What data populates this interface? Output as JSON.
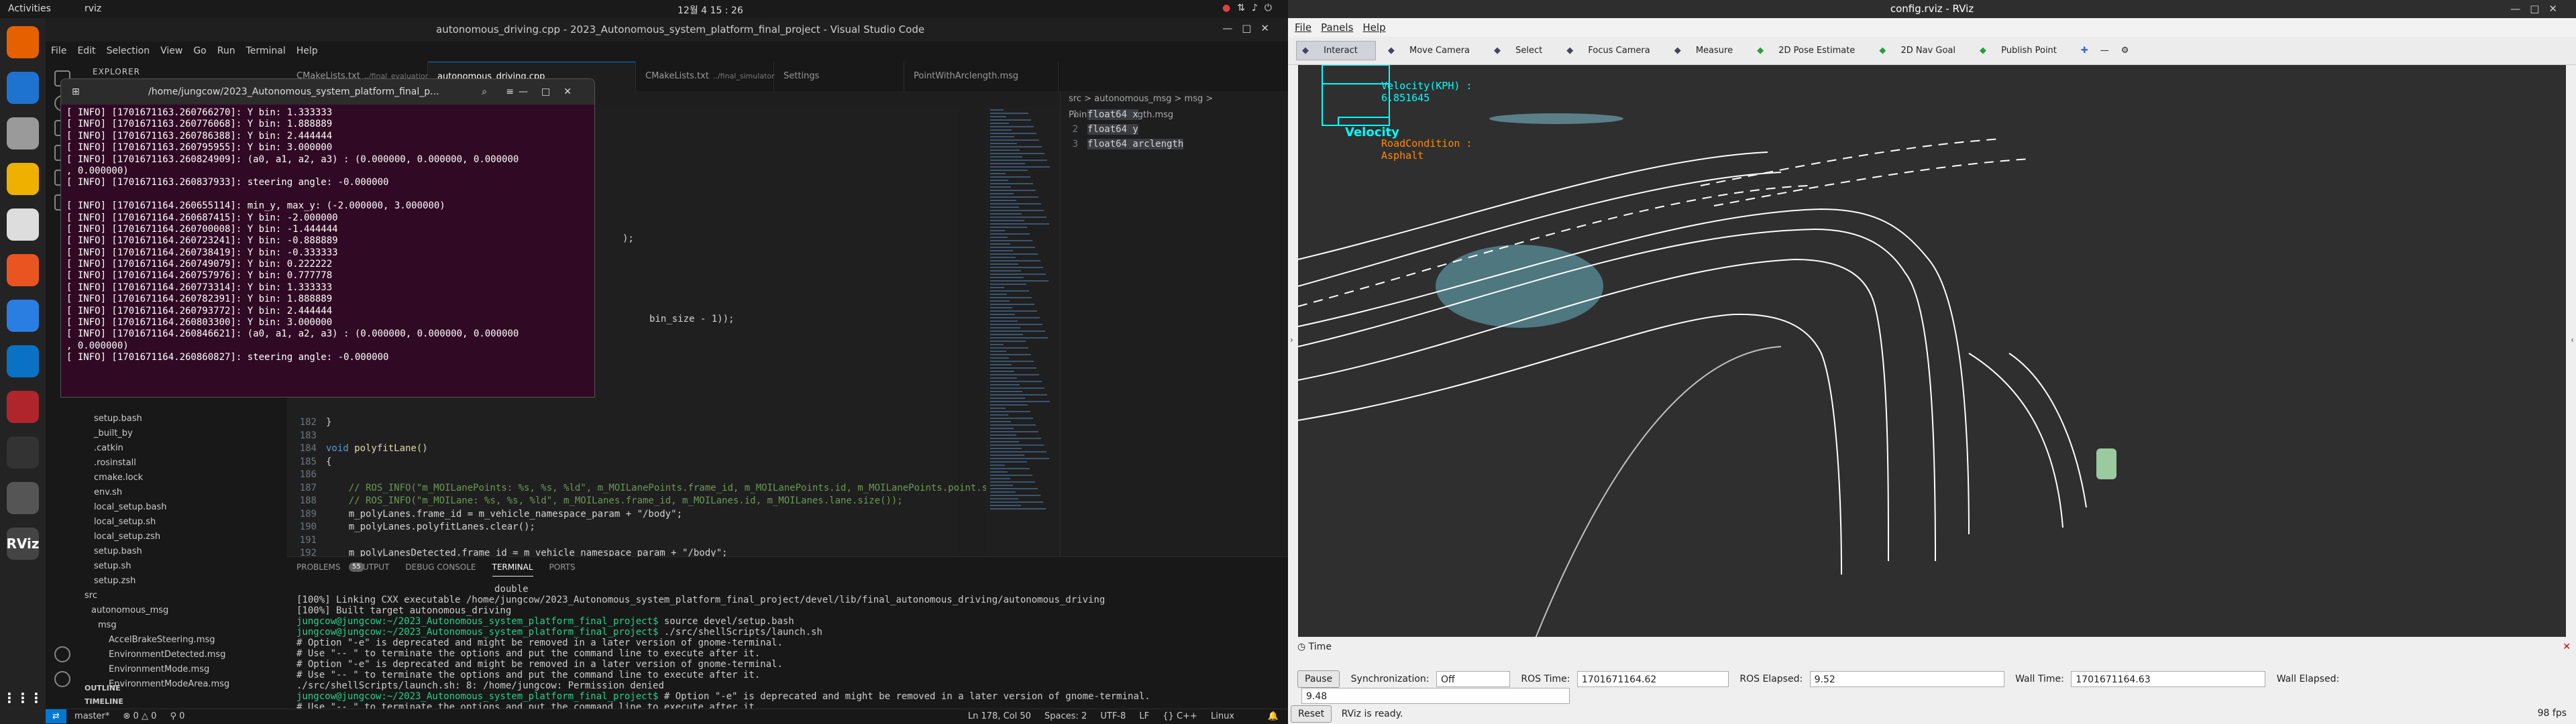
{
  "topbar": {
    "activities": "Activities",
    "app": "rviz",
    "clock": "12월 4 15 : 26"
  },
  "dock": [
    {
      "name": "firefox-icon",
      "color": "#e66000"
    },
    {
      "name": "thunderbird-icon",
      "color": "#1f73d0"
    },
    {
      "name": "files-icon",
      "color": "#9a9a9a"
    },
    {
      "name": "rhythmbox-icon",
      "color": "#f0b000"
    },
    {
      "name": "libreoffice-icon",
      "color": "#ddd"
    },
    {
      "name": "appcenter-icon",
      "color": "#e95420"
    },
    {
      "name": "help-icon",
      "color": "#2a7de1"
    },
    {
      "name": "vscode-icon",
      "color": "#0a72c4"
    },
    {
      "name": "terminal-red-icon",
      "color": "#b0252c"
    },
    {
      "name": "terminal-icon",
      "color": "#333"
    },
    {
      "name": "image-viewer-icon",
      "color": "#555"
    },
    {
      "name": "rviz-icon",
      "color": "#444",
      "label": "RViz"
    }
  ],
  "vscode": {
    "title": "autonomous_driving.cpp - 2023_Autonomous_system_platform_final_project - Visual Studio Code",
    "menu": [
      "File",
      "Edit",
      "Selection",
      "View",
      "Go",
      "Run",
      "Terminal",
      "Help"
    ],
    "explorer_title": "EXPLORER",
    "files": [
      "setup.bash",
      "_built_by",
      ".catkin",
      ".rosinstall",
      "cmake.lock",
      "env.sh",
      "local_setup.bash",
      "local_setup.sh",
      "local_setup.zsh",
      "setup.bash",
      "setup.sh",
      "setup.zsh",
      "src",
      "autonomous_msg",
      "msg",
      "AccelBrakeSteering.msg",
      "EnvironmentDetected.msg",
      "EnvironmentMode.msg",
      "EnvironmentModeArea.msg"
    ],
    "outline": "OUTLINE",
    "timeline": "TIMELINE",
    "tabs": [
      "CMakeLists.txt",
      "autonomous_driving.cpp",
      "CMakeLists.txt",
      "Settings",
      "PointWithArclength.msg"
    ],
    "tab_suffix": [
      "../final_evaluation",
      "",
      "../final_simulator",
      "",
      ""
    ],
    "breadcrumb": "src > autonomous_msg > msg > PointWithArclength.msg",
    "code": [
      {
        "n": "182",
        "k": "",
        "t": "}"
      },
      {
        "n": "183",
        "k": "",
        "t": ""
      },
      {
        "n": "184",
        "k": "void",
        "t": " polyfitLane()"
      },
      {
        "n": "185",
        "k": "",
        "t": "{"
      },
      {
        "n": "186",
        "k": "",
        "t": ""
      },
      {
        "n": "187",
        "k": "",
        "t": "    // ROS_INFO(\"m_MOILanePoints: %s, %s, %ld\", m_MOILanePoints.frame_id, m_MOILanePoints.id, m_MOILanePoints.point.size());"
      },
      {
        "n": "188",
        "k": "",
        "t": "    // ROS_INFO(\"m_MOILane: %s, %s, %ld\", m_MOILanes.frame_id, m_MOILanes.id, m_MOILanes.lane.size());"
      },
      {
        "n": "189",
        "k": "",
        "t": "    m_polyLanes.frame_id = m_vehicle_namespace_param + \"/body\";"
      },
      {
        "n": "190",
        "k": "",
        "t": "    m_polyLanes.polyfitLanes.clear();"
      },
      {
        "n": "191",
        "k": "",
        "t": ""
      },
      {
        "n": "192",
        "k": "",
        "t": "    m_polyLanesDetected.frame_id = m_vehicle_namespace_param + \"/body\";"
      }
    ],
    "code_frag1": ");",
    "code_frag2": "bin_size - 1));",
    "msg_lines": [
      "float64 x",
      "float64 y",
      "float64 arclength"
    ],
    "panel_tabs": [
      "PROBLEMS",
      "OUTPUT",
      "DEBUG CONSOLE",
      "TERMINAL",
      "PORTS"
    ],
    "problem_count": "55",
    "terminal_lines": [
      {
        "c": "tx",
        "t": "                                   double"
      },
      {
        "c": "tx",
        "t": "[100%] Linking CXX executable /home/jungcow/2023_Autonomous_system_platform_final_project/devel/lib/final_autonomous_driving/autonomous_driving"
      },
      {
        "c": "tx",
        "t": "[100%] Built target autonomous_driving"
      },
      {
        "c": "p",
        "t": "jungcow@jungcow:~/2023_Autonomous_system_platform_final_project$ source devel/setup.bash"
      },
      {
        "c": "p",
        "t": "jungcow@jungcow:~/2023_Autonomous_system_platform_final_project$ ./src/shellScripts/launch.sh"
      },
      {
        "c": "tx",
        "t": "# Option \"-e\" is deprecated and might be removed in a later version of gnome-terminal."
      },
      {
        "c": "tx",
        "t": "# Use \"-- \" to terminate the options and put the command line to execute after it."
      },
      {
        "c": "tx",
        "t": "# Option \"-e\" is deprecated and might be removed in a later version of gnome-terminal."
      },
      {
        "c": "tx",
        "t": "# Use \"-- \" to terminate the options and put the command line to execute after it."
      },
      {
        "c": "tx",
        "t": "./src/shellScripts/launch.sh: 8: /home/jungcow: Permission denied"
      },
      {
        "c": "p",
        "t": "jungcow@jungcow:~/2023_Autonomous_system_platform_final_project$ # Option \"-e\" is deprecated and might be removed in a later version of gnome-terminal."
      },
      {
        "c": "tx",
        "t": "# Use \"-- \" to terminate the options and put the command line to execute after it."
      }
    ],
    "status": {
      "branch": "master*",
      "errors": "⊗ 0 △ 0",
      "ports": "⚲ 0",
      "pos": "Ln 178, Col 50",
      "spaces": "Spaces: 2",
      "enc": "UTF-8",
      "eol": "LF",
      "lang": "{} C++",
      "os": "Linux"
    }
  },
  "gterm": {
    "title": "/home/jungcow/2023_Autonomous_system_platform_final_p...",
    "lines": [
      "[ INFO] [1701671163.260766270]: Y bin: 1.333333",
      "[ INFO] [1701671163.260776068]: Y bin: 1.888889",
      "[ INFO] [1701671163.260786388]: Y bin: 2.444444",
      "[ INFO] [1701671163.260795955]: Y bin: 3.000000",
      "[ INFO] [1701671163.260824909]: (a0, a1, a2, a3) : (0.000000, 0.000000, 0.000000",
      ", 0.000000)",
      "[ INFO] [1701671163.260837933]: steering angle: -0.000000",
      "",
      "[ INFO] [1701671164.260655114]: min_y, max_y: (-2.000000, 3.000000)",
      "[ INFO] [1701671164.260687415]: Y bin: -2.000000",
      "[ INFO] [1701671164.260700008]: Y bin: -1.444444",
      "[ INFO] [1701671164.260723241]: Y bin: -0.888889",
      "[ INFO] [1701671164.260738419]: Y bin: -0.333333",
      "[ INFO] [1701671164.260749079]: Y bin: 0.222222",
      "[ INFO] [1701671164.260757976]: Y bin: 0.777778",
      "[ INFO] [1701671164.260773314]: Y bin: 1.333333",
      "[ INFO] [1701671164.260782391]: Y bin: 1.888889",
      "[ INFO] [1701671164.260793772]: Y bin: 2.444444",
      "[ INFO] [1701671164.260803300]: Y bin: 3.000000",
      "[ INFO] [1701671164.260846621]: (a0, a1, a2, a3) : (0.000000, 0.000000, 0.000000",
      ", 0.000000)",
      "[ INFO] [1701671164.260860827]: steering angle: -0.000000"
    ]
  },
  "rviz": {
    "title": "config.rviz - RViz",
    "menu": [
      "File",
      "Panels",
      "Help"
    ],
    "tools": [
      "Interact",
      "Move Camera",
      "Select",
      "Focus Camera",
      "Measure",
      "2D Pose Estimate",
      "2D Nav Goal",
      "Publish Point"
    ],
    "overlay": {
      "velocity_label": "Velocity(KPH) :",
      "velocity_value": "6.851645",
      "velocity_title": "Velocity",
      "road_label": "RoadCondition :",
      "road_value": "Asphalt"
    },
    "time": {
      "panel": "Time",
      "pause": "Pause",
      "sync_label": "Synchronization:",
      "sync_value": "Off",
      "ros_time_label": "ROS Time:",
      "ros_time": "1701671164.62",
      "ros_elapsed_label": "ROS Elapsed:",
      "ros_elapsed": "9.52",
      "wall_time_label": "Wall Time:",
      "wall_time": "1701671164.63",
      "wall_elapsed_label": "Wall Elapsed:",
      "wall_elapsed": "9.48"
    },
    "reset": "Reset",
    "status": "RViz is ready.",
    "fps": "98 fps",
    "colors": {
      "overlay_cyan": "#00ffff",
      "road_orange": "#ff8c00",
      "lane_white": "#ffffff"
    }
  }
}
